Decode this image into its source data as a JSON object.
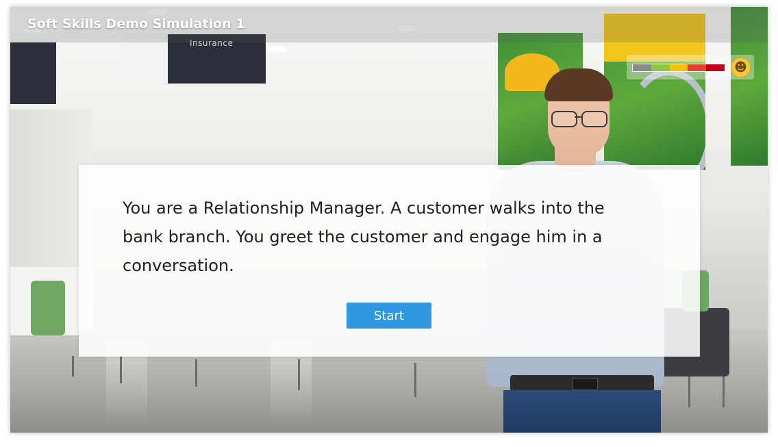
{
  "header": {
    "title": "Soft Skills Demo Simulation 1"
  },
  "scene": {
    "sign_text": "Insurance"
  },
  "meter": {
    "segment_colors": [
      "#8a8a8a",
      "#8dc63f",
      "#f4c20d",
      "#e0442e",
      "#c4001a"
    ],
    "mood_icon": "smiley-face-icon"
  },
  "dialog": {
    "message": "You are a Relationship Manager. A customer walks into the bank branch. You greet the customer and engage him in a conversation.",
    "start_label": "Start"
  },
  "colors": {
    "button": "#2f98e1",
    "title_text": "#ffffff"
  }
}
